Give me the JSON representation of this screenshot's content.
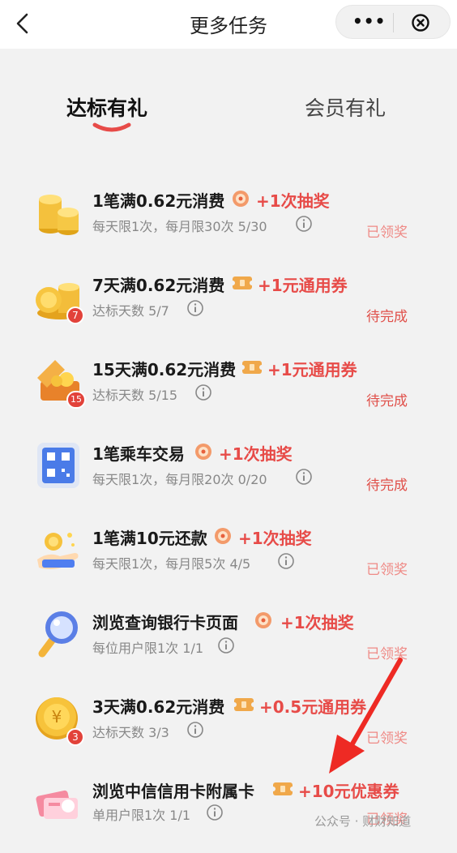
{
  "header": {
    "title": "更多任务",
    "more_icon": "ellipsis-icon",
    "close_icon": "close-circle-icon"
  },
  "tabs": [
    {
      "label": "达标有礼",
      "active": true
    },
    {
      "label": "会员有礼",
      "active": false
    }
  ],
  "tasks": [
    {
      "title": "1笔满0.62元消费",
      "reward": "+1次抽奖",
      "reward_icon": "lottery-icon",
      "subtitle": "每天限1次，每月限30次 5/30",
      "status": "已领奖",
      "icon": "coin-stack-icon"
    },
    {
      "title": "7天满0.62元消费",
      "reward": "+1元通用券",
      "reward_icon": "coupon-icon",
      "subtitle": "达标天数 5/7",
      "status": "待完成",
      "icon": "coin-pile-icon",
      "badge": "7"
    },
    {
      "title": "15天满0.62元消费",
      "reward": "+1元通用券",
      "reward_icon": "coupon-icon",
      "subtitle": "达标天数 5/15",
      "status": "待完成",
      "icon": "treasure-chest-icon",
      "badge": "15"
    },
    {
      "title": "1笔乘车交易",
      "reward": "+1次抽奖",
      "reward_icon": "lottery-icon",
      "subtitle": "每天限1次，每月限20次 0/20",
      "status": "待完成",
      "icon": "qr-code-icon"
    },
    {
      "title": "1笔满10元还款",
      "reward": "+1次抽奖",
      "reward_icon": "lottery-icon",
      "subtitle": "每天限1次，每月限5次 4/5",
      "status": "已领奖",
      "icon": "hand-coin-icon"
    },
    {
      "title": "浏览查询银行卡页面",
      "reward": "+1次抽奖",
      "reward_icon": "lottery-icon",
      "subtitle": "每位用户限1次 1/1",
      "status": "已领奖",
      "icon": "magnifier-icon"
    },
    {
      "title": "3天满0.62元消费",
      "reward": "+0.5元通用券",
      "reward_icon": "coupon-icon",
      "subtitle": "达标天数 3/3",
      "status": "已领奖",
      "icon": "yuan-coin-icon",
      "badge": "3"
    },
    {
      "title": "浏览中信信用卡附属卡",
      "reward": "+10元优惠券",
      "reward_icon": "coupon-icon",
      "subtitle": "单用户限1次 1/1",
      "status": "已领奖",
      "icon": "card-gift-icon"
    }
  ],
  "watermark": "公众号 · 财财知道",
  "colors": {
    "accent": "#e74b48",
    "claimed": "#ef8a86",
    "pending": "#e0504a",
    "background": "#f2f2f2"
  }
}
